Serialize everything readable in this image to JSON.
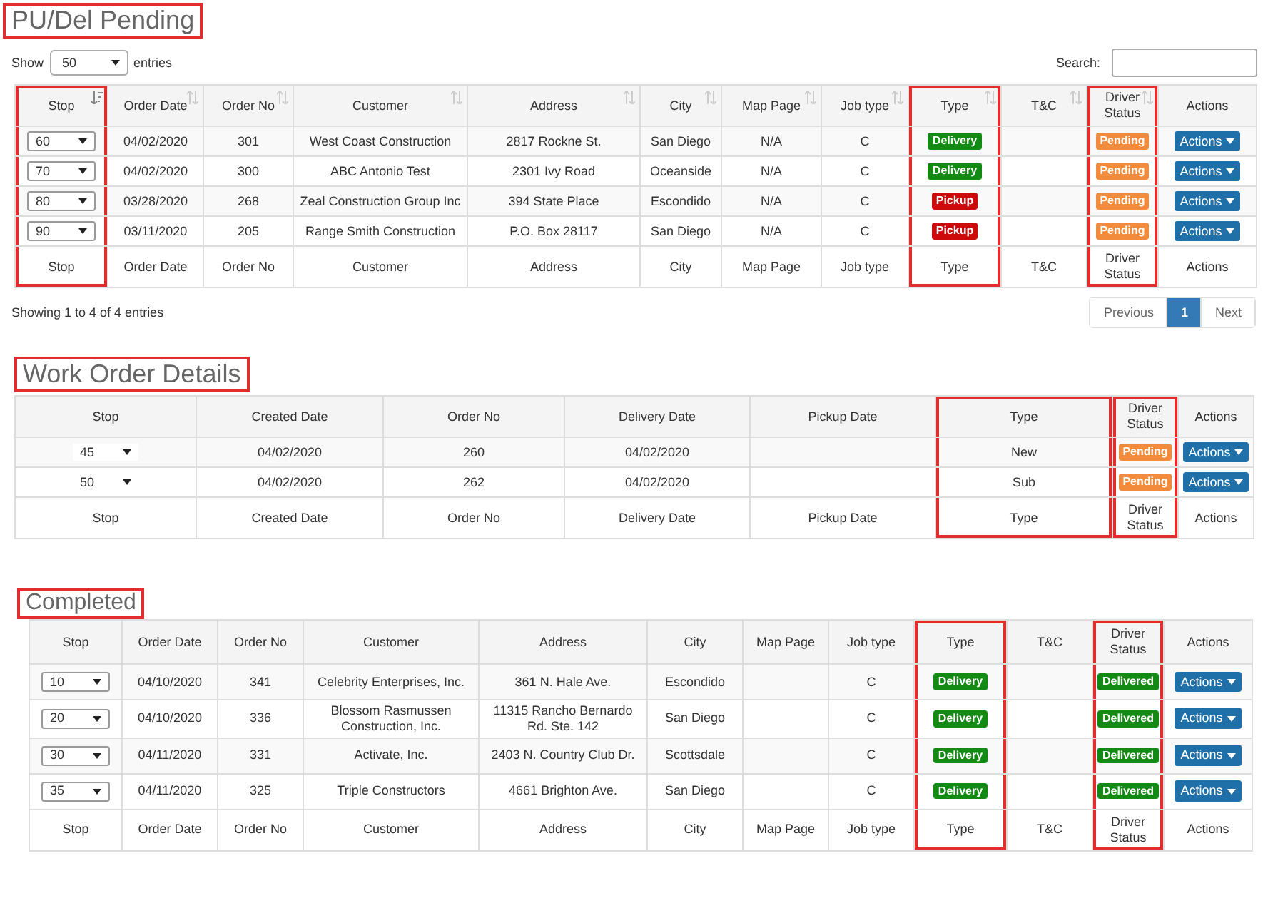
{
  "sections": [
    {
      "title": {
        "text": "PU/Del Pending",
        "highlighted": true
      },
      "controls": {
        "show_label": "Show",
        "page_size": "50",
        "entries_label": "entries",
        "search_label": "Search:"
      },
      "table": {
        "columns": [
          {
            "label": "Stop",
            "sortable": true,
            "sorted": true,
            "highlighted": true
          },
          {
            "label": "Order Date",
            "sortable": true,
            "sorted": false,
            "highlighted": false
          },
          {
            "label": "Order No",
            "sortable": true,
            "sorted": false,
            "highlighted": false
          },
          {
            "label": "Customer",
            "sortable": true,
            "sorted": false,
            "highlighted": false
          },
          {
            "label": "Address",
            "sortable": true,
            "sorted": false,
            "highlighted": false
          },
          {
            "label": "City",
            "sortable": true,
            "sorted": false,
            "highlighted": false
          },
          {
            "label": "Map Page",
            "sortable": true,
            "sorted": false,
            "highlighted": false
          },
          {
            "label": "Job type",
            "sortable": true,
            "sorted": false,
            "highlighted": false
          },
          {
            "label": "Type",
            "sortable": true,
            "sorted": false,
            "highlighted": true
          },
          {
            "label": "T&C",
            "sortable": true,
            "sorted": false,
            "highlighted": false
          },
          {
            "label": "Driver Status",
            "sortable": true,
            "sorted": false,
            "highlighted": true
          },
          {
            "label": "Actions",
            "highlighted": false
          }
        ],
        "rows": [
          [
            {
              "kind": "select",
              "value": "60",
              "boxed": true
            },
            "04/02/2020",
            "301",
            "West Coast Construction",
            "2817 Rockne St.",
            "San Diego",
            "N/A",
            "C",
            {
              "kind": "badge",
              "text": "Delivery",
              "color": "#138a13"
            },
            "",
            {
              "kind": "badge",
              "text": "Pending",
              "color": "#f38b3c"
            },
            {
              "kind": "button",
              "text": "Actions"
            }
          ],
          [
            {
              "kind": "select",
              "value": "70",
              "boxed": true
            },
            "04/02/2020",
            "300",
            "ABC Antonio Test",
            "2301 Ivy Road",
            "Oceanside",
            "N/A",
            "C",
            {
              "kind": "badge",
              "text": "Delivery",
              "color": "#138a13"
            },
            "",
            {
              "kind": "badge",
              "text": "Pending",
              "color": "#f38b3c"
            },
            {
              "kind": "button",
              "text": "Actions"
            }
          ],
          [
            {
              "kind": "select",
              "value": "80",
              "boxed": true
            },
            "03/28/2020",
            "268",
            "Zeal Construction Group Inc",
            "394 State Place",
            "Escondido",
            "N/A",
            "C",
            {
              "kind": "badge",
              "text": "Pickup",
              "color": "#cc0a0a"
            },
            "",
            {
              "kind": "badge",
              "text": "Pending",
              "color": "#f38b3c"
            },
            {
              "kind": "button",
              "text": "Actions"
            }
          ],
          [
            {
              "kind": "select",
              "value": "90",
              "boxed": true
            },
            "03/11/2020",
            "205",
            "Range Smith Construction",
            "P.O. Box 28117",
            "San Diego",
            "N/A",
            "C",
            {
              "kind": "badge",
              "text": "Pickup",
              "color": "#cc0a0a"
            },
            "",
            {
              "kind": "badge",
              "text": "Pending",
              "color": "#f38b3c"
            },
            {
              "kind": "button",
              "text": "Actions"
            }
          ]
        ],
        "footer": [
          "Stop",
          "Order Date",
          "Order No",
          "Customer",
          "Address",
          "City",
          "Map Page",
          "Job type",
          "Type",
          "T&C",
          "Driver Status",
          "Actions"
        ]
      },
      "info": "Showing 1 to 4 of 4 entries",
      "pagination": [
        {
          "label": "Previous",
          "selected": false
        },
        {
          "label": "1",
          "selected": true
        },
        {
          "label": "Next",
          "selected": false
        }
      ]
    },
    {
      "title": {
        "text": "Work Order Details",
        "highlighted": true
      },
      "table": {
        "columns": [
          {
            "label": "Stop",
            "highlighted": false
          },
          {
            "label": "Created Date",
            "highlighted": false
          },
          {
            "label": "Order No",
            "highlighted": false
          },
          {
            "label": "Delivery Date",
            "highlighted": false
          },
          {
            "label": "Pickup Date",
            "highlighted": false
          },
          {
            "label": "Type",
            "highlighted": true
          },
          {
            "label": "Driver Status",
            "highlighted": true
          },
          {
            "label": "Actions",
            "highlighted": false
          }
        ],
        "rows": [
          [
            {
              "kind": "select",
              "value": "45",
              "boxed": false
            },
            "04/02/2020",
            "260",
            "04/02/2020",
            "",
            "New",
            {
              "kind": "badge",
              "text": "Pending",
              "color": "#f38b3c"
            },
            {
              "kind": "button",
              "text": "Actions"
            }
          ],
          [
            {
              "kind": "select",
              "value": "50",
              "boxed": false
            },
            "04/02/2020",
            "262",
            "04/02/2020",
            "",
            "Sub",
            {
              "kind": "badge",
              "text": "Pending",
              "color": "#f38b3c"
            },
            {
              "kind": "button",
              "text": "Actions"
            }
          ]
        ],
        "footer": [
          "Stop",
          "Created Date",
          "Order No",
          "Delivery Date",
          "Pickup Date",
          "Type",
          "Driver Status",
          "Actions"
        ]
      }
    },
    {
      "title": {
        "text": "Completed",
        "highlighted": true
      },
      "table": {
        "columns": [
          {
            "label": "Stop",
            "highlighted": false
          },
          {
            "label": "Order Date",
            "highlighted": false
          },
          {
            "label": "Order No",
            "highlighted": false
          },
          {
            "label": "Customer",
            "highlighted": false
          },
          {
            "label": "Address",
            "highlighted": false
          },
          {
            "label": "City",
            "highlighted": false
          },
          {
            "label": "Map Page",
            "highlighted": false
          },
          {
            "label": "Job type",
            "highlighted": false
          },
          {
            "label": "Type",
            "highlighted": true
          },
          {
            "label": "T&C",
            "highlighted": false
          },
          {
            "label": "Driver Status",
            "highlighted": true
          },
          {
            "label": "Actions",
            "highlighted": false
          }
        ],
        "rows": [
          [
            {
              "kind": "select",
              "value": "10",
              "boxed": true
            },
            "04/10/2020",
            "341",
            "Celebrity Enterprises, Inc.",
            "361 N. Hale Ave.",
            "Escondido",
            "",
            "C",
            {
              "kind": "badge",
              "text": "Delivery",
              "color": "#138a13"
            },
            "",
            {
              "kind": "badge",
              "text": "Delivered",
              "color": "#138a13"
            },
            {
              "kind": "button",
              "text": "Actions"
            }
          ],
          [
            {
              "kind": "select",
              "value": "20",
              "boxed": true
            },
            "04/10/2020",
            "336",
            "Blossom Rasmussen Construction, Inc.",
            "11315 Rancho Bernardo Rd. Ste. 142",
            "San Diego",
            "",
            "C",
            {
              "kind": "badge",
              "text": "Delivery",
              "color": "#138a13"
            },
            "",
            {
              "kind": "badge",
              "text": "Delivered",
              "color": "#138a13"
            },
            {
              "kind": "button",
              "text": "Actions"
            }
          ],
          [
            {
              "kind": "select",
              "value": "30",
              "boxed": true
            },
            "04/11/2020",
            "331",
            "Activate, Inc.",
            "2403 N. Country Club Dr.",
            "Scottsdale",
            "",
            "C",
            {
              "kind": "badge",
              "text": "Delivery",
              "color": "#138a13"
            },
            "",
            {
              "kind": "badge",
              "text": "Delivered",
              "color": "#138a13"
            },
            {
              "kind": "button",
              "text": "Actions"
            }
          ],
          [
            {
              "kind": "select",
              "value": "35",
              "boxed": true
            },
            "04/11/2020",
            "325",
            "Triple Constructors",
            "4661 Brighton Ave.",
            "San Diego",
            "",
            "C",
            {
              "kind": "badge",
              "text": "Delivery",
              "color": "#138a13"
            },
            "",
            {
              "kind": "badge",
              "text": "Delivered",
              "color": "#138a13"
            },
            {
              "kind": "button",
              "text": "Actions"
            }
          ]
        ],
        "footer": [
          "Stop",
          "Order Date",
          "Order No",
          "Customer",
          "Address",
          "City",
          "Map Page",
          "Job type",
          "Type",
          "T&C",
          "Driver Status",
          "Actions"
        ]
      }
    }
  ]
}
